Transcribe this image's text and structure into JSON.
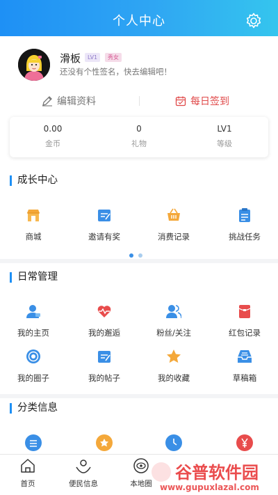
{
  "header": {
    "title": "个人中心"
  },
  "profile": {
    "username": "滑板",
    "level_badge": "LV1",
    "gender_badge": "秀女",
    "signature": "还没有个性签名，快去编辑吧！"
  },
  "actions": {
    "edit": "编辑资料",
    "checkin": "每日签到"
  },
  "stats": [
    {
      "value": "0.00",
      "label": "金币"
    },
    {
      "value": "0",
      "label": "礼物"
    },
    {
      "value": "LV1",
      "label": "等级"
    }
  ],
  "growth": {
    "title": "成长中心",
    "items": [
      {
        "label": "商城"
      },
      {
        "label": "邀请有奖"
      },
      {
        "label": "消费记录"
      },
      {
        "label": "挑战任务"
      }
    ]
  },
  "daily": {
    "title": "日常管理",
    "items": [
      {
        "label": "我的主页"
      },
      {
        "label": "我的邂逅"
      },
      {
        "label": "粉丝/关注"
      },
      {
        "label": "红包记录"
      },
      {
        "label": "我的圈子"
      },
      {
        "label": "我的帖子"
      },
      {
        "label": "我的收藏"
      },
      {
        "label": "草稿箱"
      }
    ]
  },
  "category": {
    "title": "分类信息"
  },
  "tabbar": {
    "items": [
      {
        "label": "首页"
      },
      {
        "label": "便民信息"
      },
      {
        "label": "本地圈"
      }
    ]
  },
  "watermark": {
    "brand": "谷普软件园",
    "url": "www.gupuxlazal.com"
  },
  "colors": {
    "accent": "#1e90f5",
    "checkin": "#e04848",
    "orange": "#f4a83a",
    "red": "#e84c4c"
  }
}
